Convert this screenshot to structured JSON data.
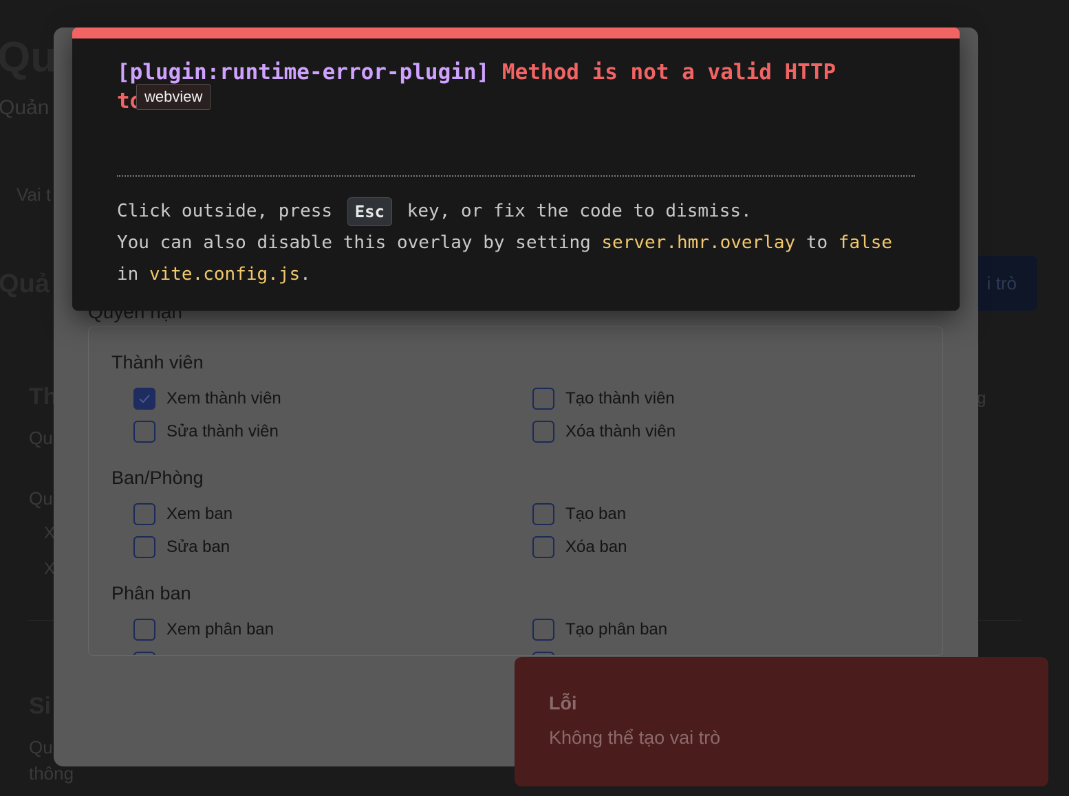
{
  "background": {
    "title_fragment": "Qu",
    "subtitle_fragment": "Quản",
    "tab_fragment": "Vai t",
    "section_fragment": "Quả",
    "create_button_fragment": "i trò",
    "card1": {
      "title_fragment": "Th",
      "subtitle_fragment": "Qu",
      "perm_fragment": "Qu",
      "item1_fragment": "X",
      "item2_fragment": "X",
      "right_fragment": "g"
    },
    "card2": {
      "title_fragment": "Si",
      "subtitle_line1_fragment": "Qu",
      "subtitle_line2_fragment": "thông"
    }
  },
  "modal": {
    "permissions_heading": "Quyền hạn",
    "groups": [
      {
        "title": "Thành viên",
        "items": [
          {
            "label": "Xem thành viên",
            "checked": true
          },
          {
            "label": "Tạo thành viên",
            "checked": false
          },
          {
            "label": "Sửa thành viên",
            "checked": false
          },
          {
            "label": "Xóa thành viên",
            "checked": false
          }
        ]
      },
      {
        "title": "Ban/Phòng",
        "items": [
          {
            "label": "Xem ban",
            "checked": false
          },
          {
            "label": "Tạo ban",
            "checked": false
          },
          {
            "label": "Sửa ban",
            "checked": false
          },
          {
            "label": "Xóa ban",
            "checked": false
          }
        ]
      },
      {
        "title": "Phân ban",
        "items": [
          {
            "label": "Xem phân ban",
            "checked": false
          },
          {
            "label": "Tạo phân ban",
            "checked": false
          }
        ]
      }
    ]
  },
  "error_overlay": {
    "plugin": "[plugin:runtime-error-plugin]",
    "message_line1": "Method is not a valid HTTP",
    "message_line2_fragment": "to",
    "tooltip": "webview",
    "tip_prefix": "Click outside, press",
    "tip_key": "Esc",
    "tip_suffix": "key, or fix the code to dismiss.",
    "tip2_prefix": "You can also disable this overlay by setting",
    "tip2_code": "server.hmr.overlay",
    "tip2_middle": "to",
    "tip2_value": "false",
    "tip3_prefix": "in",
    "tip3_file": "vite.config.js",
    "tip3_suffix": "."
  },
  "toast": {
    "title": "Lỗi",
    "description": "Không thể tạo vai trò"
  },
  "colors": {
    "error_accent": "#f26464",
    "plugin_purple": "#cfa2ff",
    "code_yellow": "#f2c86e",
    "checkbox_navy": "#1e2c60",
    "toast_bg": "#4b1c1c"
  }
}
